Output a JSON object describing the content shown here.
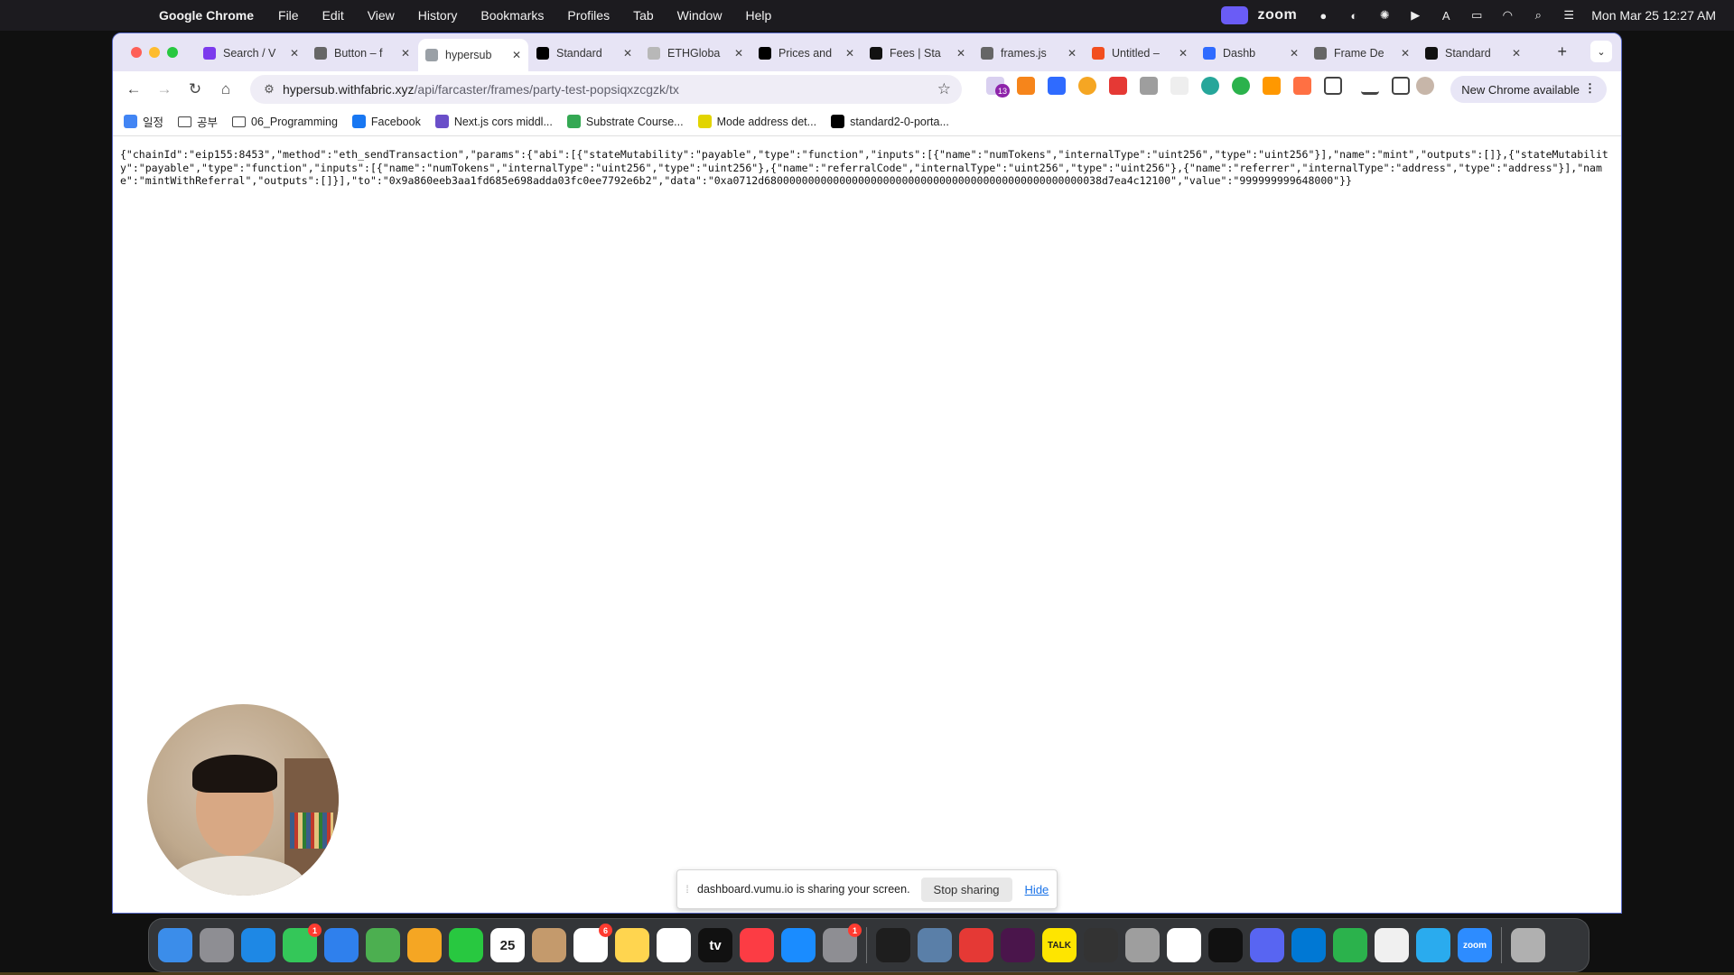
{
  "menubar": {
    "app_name": "Google Chrome",
    "menus": [
      "File",
      "Edit",
      "View",
      "History",
      "Bookmarks",
      "Profiles",
      "Tab",
      "Window",
      "Help"
    ],
    "zoom_label": "zoom",
    "clock": "Mon Mar 25  12:27 AM"
  },
  "tabs": [
    {
      "title": "Search / V",
      "favicon": "warpcast-icon",
      "color": "#7c3aed",
      "active": false
    },
    {
      "title": "Button – f",
      "favicon": "globe-icon",
      "color": "#666666",
      "active": false
    },
    {
      "title": "hypersub",
      "favicon": "hypersub-icon",
      "color": "#9aa0a6",
      "active": true
    },
    {
      "title": "Standard",
      "favicon": "x-icon",
      "color": "#000000",
      "active": false
    },
    {
      "title": "ETHGloba",
      "favicon": "ethglobal-icon",
      "color": "#b8b8b8",
      "active": false
    },
    {
      "title": "Prices and",
      "favicon": "sc-icon",
      "color": "#000000",
      "active": false
    },
    {
      "title": "Fees | Sta",
      "favicon": "standard-icon",
      "color": "#111111",
      "active": false
    },
    {
      "title": "frames.js",
      "favicon": "globe-icon",
      "color": "#666666",
      "active": false
    },
    {
      "title": "Untitled –",
      "favicon": "figma-icon",
      "color": "#f24e1e",
      "active": false
    },
    {
      "title": "Dashb",
      "favicon": "vumu-icon",
      "color": "#2f6bff",
      "active": false
    },
    {
      "title": "Frame De",
      "favicon": "globe-icon",
      "color": "#666666",
      "active": false
    },
    {
      "title": "Standard",
      "favicon": "standard-icon",
      "color": "#111111",
      "active": false
    }
  ],
  "address_bar": {
    "host": "hypersub.withfabric.xyz",
    "path": "/api/farcaster/frames/party-test-popsiqxzcgzk/tx"
  },
  "update_button": "New Chrome available",
  "extension_badge": "13",
  "bookmarks": [
    {
      "label": "일정",
      "icon": "calendar-icon",
      "color": "#4285f4"
    },
    {
      "label": "공부",
      "icon": "folder-icon",
      "color": "#ffffff"
    },
    {
      "label": "06_Programming",
      "icon": "folder-icon",
      "color": "#ffffff"
    },
    {
      "label": "Facebook",
      "icon": "facebook-icon",
      "color": "#1877f2"
    },
    {
      "label": "Next.js cors middl...",
      "icon": "bookmark-icon",
      "color": "#6a4fc9"
    },
    {
      "label": "Substrate Course...",
      "icon": "plus-icon",
      "color": "#34a853"
    },
    {
      "label": "Mode address det...",
      "icon": "mode-icon",
      "color": "#e2d400"
    },
    {
      "label": "standard2-0-porta...",
      "icon": "triangle-icon",
      "color": "#000000"
    }
  ],
  "page_text": "{\"chainId\":\"eip155:8453\",\"method\":\"eth_sendTransaction\",\"params\":{\"abi\":[{\"stateMutability\":\"payable\",\"type\":\"function\",\"inputs\":[{\"name\":\"numTokens\",\"internalType\":\"uint256\",\"type\":\"uint256\"}],\"name\":\"mint\",\"outputs\":[]},{\"stateMutability\":\"payable\",\"type\":\"function\",\"inputs\":[{\"name\":\"numTokens\",\"internalType\":\"uint256\",\"type\":\"uint256\"},{\"name\":\"referralCode\",\"internalType\":\"uint256\",\"type\":\"uint256\"},{\"name\":\"referrer\",\"internalType\":\"address\",\"type\":\"address\"}],\"name\":\"mintWithReferral\",\"outputs\":[]}],\"to\":\"0x9a860eeb3aa1fd685e698adda03fc0ee7792e6b2\",\"data\":\"0xa0712d680000000000000000000000000000000000000000000000000038d7ea4c12100\",\"value\":\"999999999648000\"}}",
  "share_bar": {
    "message": "dashboard.vumu.io is sharing your screen.",
    "stop_label": "Stop sharing",
    "hide_label": "Hide"
  },
  "dock": {
    "apps": [
      {
        "name": "finder",
        "color": "#3b8dea"
      },
      {
        "name": "launchpad",
        "color": "#8e8e93"
      },
      {
        "name": "safari",
        "color": "#1e88e5"
      },
      {
        "name": "messages",
        "color": "#34c759",
        "badge": "1"
      },
      {
        "name": "mail",
        "color": "#2f80ed"
      },
      {
        "name": "maps",
        "color": "#4caf50"
      },
      {
        "name": "photos",
        "color": "#f5a623"
      },
      {
        "name": "facetime",
        "color": "#28c840"
      },
      {
        "name": "calendar",
        "color": "#ffffff",
        "label": "25"
      },
      {
        "name": "contacts",
        "color": "#c49a6c"
      },
      {
        "name": "reminders",
        "color": "#ffffff",
        "badge": "6"
      },
      {
        "name": "notes",
        "color": "#ffd54f"
      },
      {
        "name": "freeform",
        "color": "#ffffff"
      },
      {
        "name": "tv",
        "color": "#111111",
        "label": "tv"
      },
      {
        "name": "music",
        "color": "#fc3c44"
      },
      {
        "name": "app-store",
        "color": "#1a8cff"
      },
      {
        "name": "system-settings",
        "color": "#8e8e93",
        "badge": "1"
      },
      {
        "name": "terminal",
        "color": "#1e1e1e"
      },
      {
        "name": "preview",
        "color": "#5a7fa8"
      },
      {
        "name": "pdf-expert",
        "color": "#e53935"
      },
      {
        "name": "slack",
        "color": "#4a154b"
      },
      {
        "name": "kakaotalk",
        "color": "#fee500",
        "label": "TALK"
      },
      {
        "name": "calculator",
        "color": "#333333"
      },
      {
        "name": "font-book",
        "color": "#9e9e9e"
      },
      {
        "name": "chrome",
        "color": "#ffffff"
      },
      {
        "name": "cursor",
        "color": "#111111"
      },
      {
        "name": "discord",
        "color": "#5865f2"
      },
      {
        "name": "vscode",
        "color": "#0078d4"
      },
      {
        "name": "numbers",
        "color": "#2bb24c"
      },
      {
        "name": "textedit",
        "color": "#f0f0f0"
      },
      {
        "name": "telegram",
        "color": "#2aabee"
      },
      {
        "name": "zoom",
        "color": "#2d8cff",
        "label": "zoom"
      },
      {
        "name": "trash",
        "color": "#b0b0b0"
      }
    ]
  }
}
